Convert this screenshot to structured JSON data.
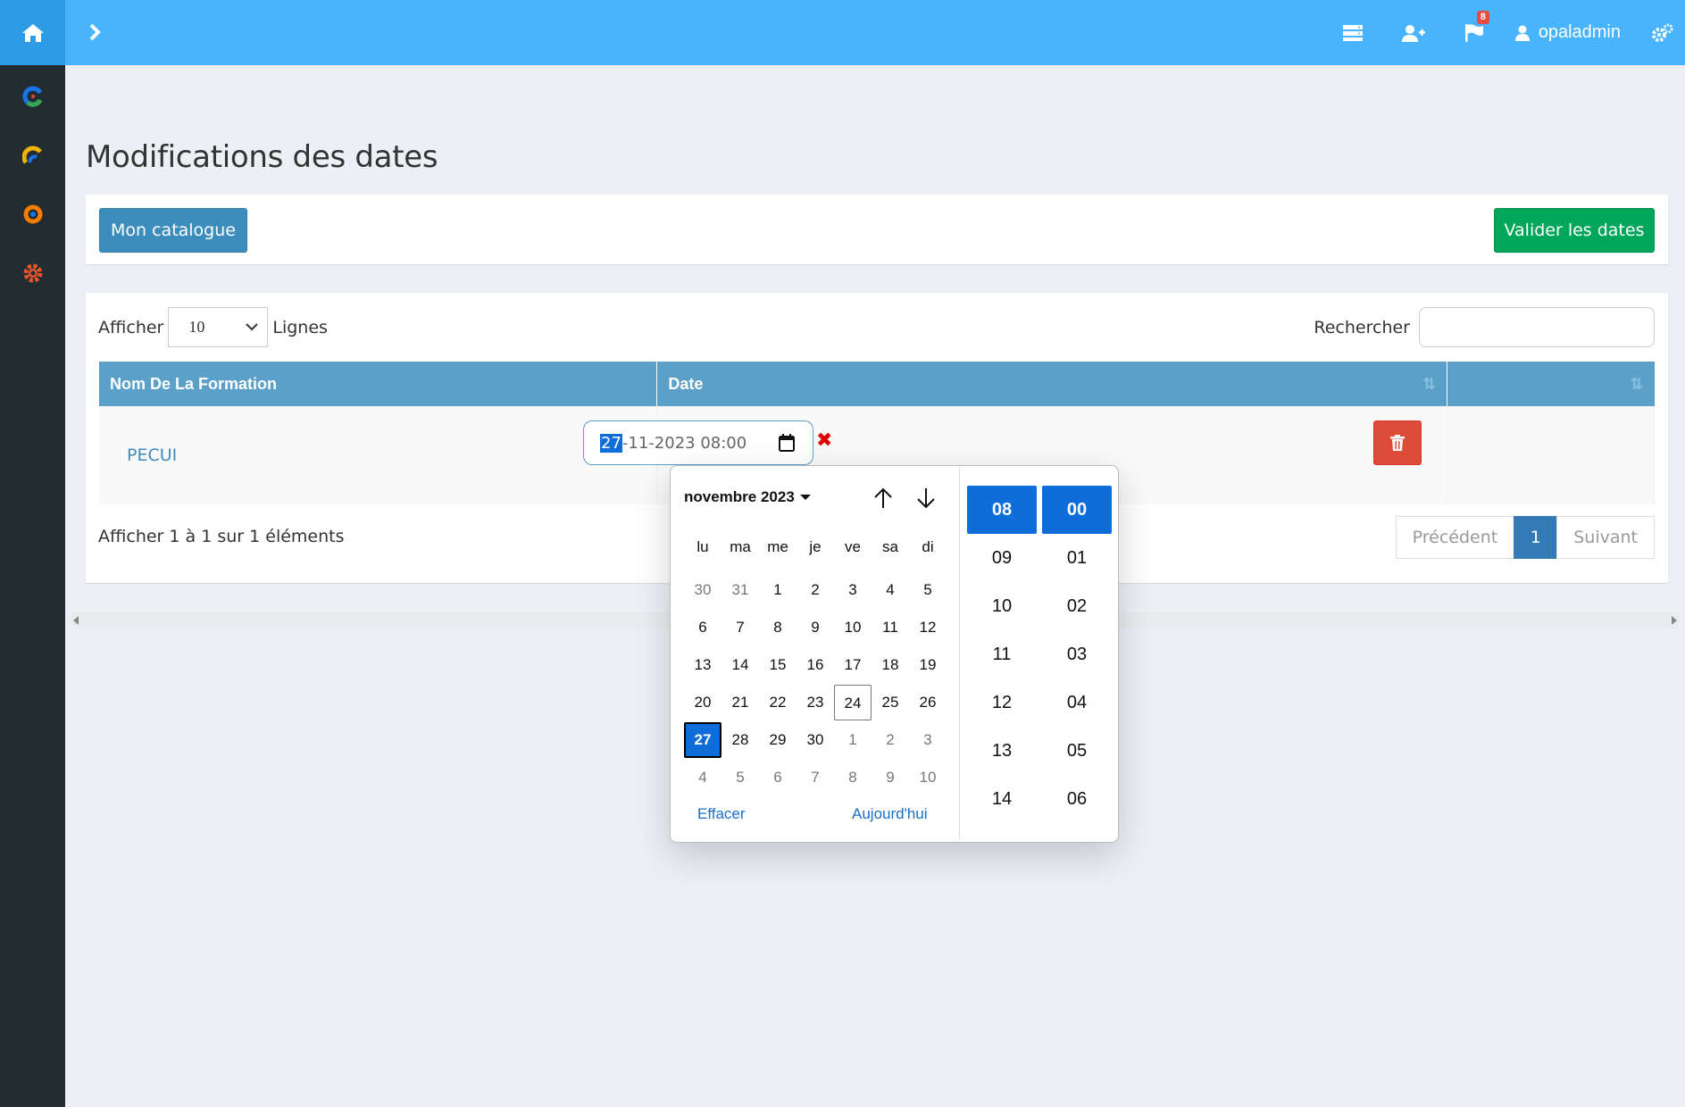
{
  "topbar": {
    "username": "opaladmin",
    "notification_count": "8",
    "icons": [
      "home-icon",
      "chevron-right-icon",
      "server-icon",
      "user-plus-icon",
      "flag-icon",
      "user-icon",
      "gears-icon"
    ]
  },
  "sidebar": {
    "items": [
      {
        "name": "app-logo-c",
        "color": "#1a73e8"
      },
      {
        "name": "app-logo-arc",
        "color": "#f0b400"
      },
      {
        "name": "app-logo-ring",
        "color": "#f57c00"
      },
      {
        "name": "settings-gear",
        "color": "#e8542c"
      }
    ]
  },
  "page": {
    "title": "Modifications des dates"
  },
  "toolbar": {
    "catalogue_label": "Mon catalogue",
    "validate_label": "Valider les dates"
  },
  "table_controls": {
    "show_label": "Afficher",
    "page_size": "10",
    "lines_label": "Lignes",
    "search_label": "Rechercher"
  },
  "table": {
    "columns": [
      "Nom De La Formation",
      "Date",
      ""
    ],
    "rows": [
      {
        "name": "PECUI",
        "date_day": "27",
        "date_rest": "-11-2023 08:00"
      }
    ]
  },
  "footer": {
    "info": "Afficher 1 à 1 sur 1 éléments",
    "prev_label": "Précédent",
    "current_page": "1",
    "next_label": "Suivant"
  },
  "datepicker": {
    "month_label": "novembre 2023",
    "weekdays": [
      "lu",
      "ma",
      "me",
      "je",
      "ve",
      "sa",
      "di"
    ],
    "weeks": [
      [
        "30",
        "31",
        "1",
        "2",
        "3",
        "4",
        "5"
      ],
      [
        "6",
        "7",
        "8",
        "9",
        "10",
        "11",
        "12"
      ],
      [
        "13",
        "14",
        "15",
        "16",
        "17",
        "18",
        "19"
      ],
      [
        "20",
        "21",
        "22",
        "23",
        "24",
        "25",
        "26"
      ],
      [
        "27",
        "28",
        "29",
        "30",
        "1",
        "2",
        "3"
      ],
      [
        "4",
        "5",
        "6",
        "7",
        "8",
        "9",
        "10"
      ]
    ],
    "today": "24",
    "selected": "27",
    "clear_label": "Effacer",
    "today_label": "Aujourd'hui",
    "hours": [
      "08",
      "09",
      "10",
      "11",
      "12",
      "13",
      "14"
    ],
    "minutes": [
      "00",
      "01",
      "02",
      "03",
      "04",
      "05",
      "06"
    ],
    "selected_hour": "08",
    "selected_minute": "00",
    "accent_color": "#0e6dd8"
  },
  "colors": {
    "topbar": "#47b4fd",
    "sidebar": "#222d32",
    "primary_button": "#3c8dbc",
    "success_button": "#00a65a",
    "danger_button": "#dd4b39",
    "table_header": "#5aa0c9"
  }
}
